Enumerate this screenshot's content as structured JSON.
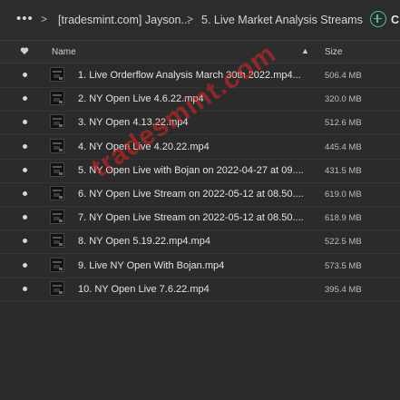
{
  "breadcrumb": {
    "more": "•••",
    "separator": ">",
    "parent": "[tradesmint.com] Jayson...",
    "current": "5. Live Market Analysis Streams"
  },
  "toolbar": {
    "add_label": "C"
  },
  "table": {
    "columns": {
      "name": "Name",
      "size": "Size"
    },
    "sort_indicator": "▲",
    "rows": [
      {
        "name": "1. Live Orderflow Analysis March 30th 2022.mp4...",
        "size": "506.4 MB"
      },
      {
        "name": "2. NY Open Live 4.6.22.mp4",
        "size": "320.0 MB"
      },
      {
        "name": "3. NY Open 4.13.22.mp4",
        "size": "512.6 MB"
      },
      {
        "name": "4. NY Open Live 4.20.22.mp4",
        "size": "445.4 MB"
      },
      {
        "name": "5. NY Open Live with Bojan on 2022-04-27 at 09....",
        "size": "431.5 MB"
      },
      {
        "name": "6. NY Open Live Stream on 2022-05-12 at 08.50....",
        "size": "619.0 MB"
      },
      {
        "name": "7. NY Open Live Stream on 2022-05-12 at 08.50....",
        "size": "618.9 MB"
      },
      {
        "name": "8. NY Open 5.19.22.mp4.mp4",
        "size": "522.5 MB"
      },
      {
        "name": "9. Live NY Open With Bojan.mp4",
        "size": "573.5 MB"
      },
      {
        "name": "10. NY Open Live 7.6.22.mp4",
        "size": "395.4 MB"
      }
    ]
  },
  "watermark": "tradesmint.com",
  "colors": {
    "background": "#2b2b2b",
    "accent": "#4fc08d",
    "watermark": "#e22424"
  },
  "icons": {
    "favorite_column": "heart-icon",
    "add": "plus-circle-icon",
    "file": "video-thumbnail-icon",
    "row_marker": "dot-icon"
  }
}
